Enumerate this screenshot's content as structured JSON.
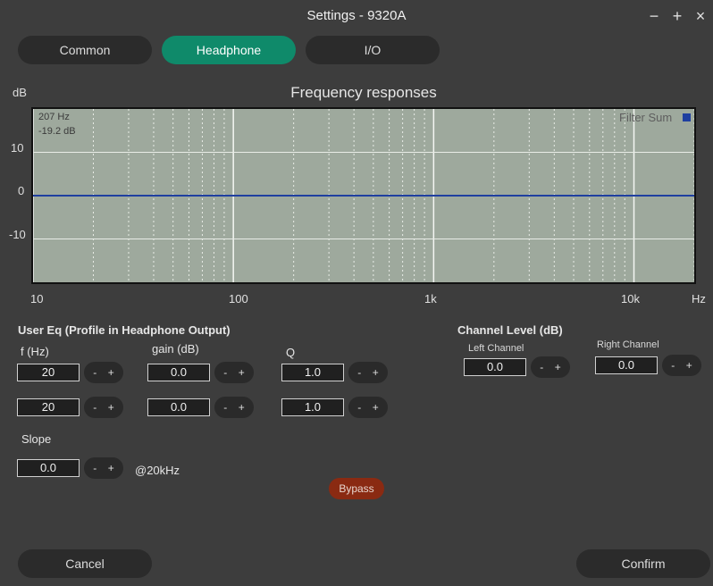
{
  "window": {
    "title": "Settings  - 9320A",
    "minimize": "−",
    "maximize": "+",
    "close": "×"
  },
  "tabs": [
    {
      "label": "Common",
      "active": false
    },
    {
      "label": "Headphone",
      "active": true
    },
    {
      "label": "I/O",
      "active": false
    }
  ],
  "chart_data": {
    "type": "line",
    "title": "Frequency responses",
    "ylabel": "dB",
    "xlabel": "Hz",
    "x_scale": "log",
    "xlim": [
      10,
      20000
    ],
    "ylim": [
      -20,
      20
    ],
    "x_ticks": [
      "10",
      "100",
      "1k",
      "10k"
    ],
    "x_tick_values": [
      10,
      100,
      1000,
      10000
    ],
    "y_ticks": [
      "10",
      "0",
      "-10"
    ],
    "y_tick_values": [
      10,
      0,
      -10
    ],
    "grid": true,
    "legend_position": "top-right",
    "series": [
      {
        "name": "Filter Sum",
        "color": "#1f3fa0",
        "x": [
          10,
          20000
        ],
        "y": [
          0,
          0
        ]
      }
    ],
    "readout": {
      "freq": "207 Hz",
      "level": "-19.2 dB"
    }
  },
  "user_eq": {
    "title": "User Eq  (Profile in Headphone Output)",
    "f_label": "f (Hz)",
    "gain_label": "gain (dB)",
    "q_label": "Q",
    "rows": [
      {
        "f": "20",
        "gain": "0.0",
        "q": "1.0"
      },
      {
        "f": "20",
        "gain": "0.0",
        "q": "1.0"
      }
    ],
    "slope_label": "Slope",
    "slope_value": "0.0",
    "slope_unit": "@20kHz"
  },
  "stepper": {
    "minus": "-",
    "plus": "+"
  },
  "channel_level": {
    "title": "Channel Level (dB)",
    "left_label": "Left Channel",
    "left_value": "0.0",
    "right_label": "Right Channel",
    "right_value": "0.0"
  },
  "bypass_label": "Bypass",
  "footer": {
    "cancel_label": "Cancel",
    "confirm_label": "Confirm"
  }
}
